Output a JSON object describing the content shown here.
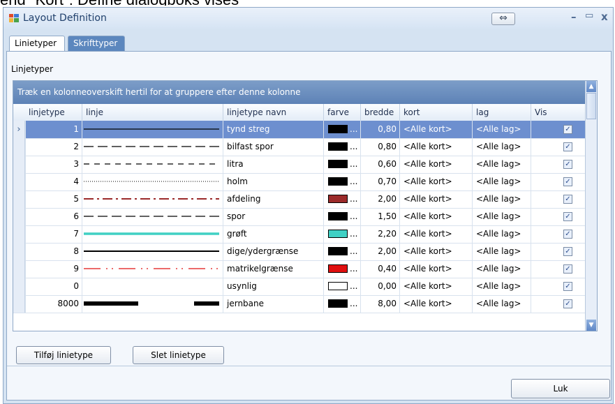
{
  "caption_text": "end \"Kort\": Define dialogboks vises",
  "window": {
    "title": "Layout Definition",
    "swap_glyph": "⇔",
    "minimize": "–",
    "maximize": "▭",
    "close": "x"
  },
  "tabs": [
    {
      "label": "Linietyper",
      "active": true
    },
    {
      "label": "Skrifttyper",
      "active": false
    }
  ],
  "section_label": "Linjetyper",
  "grid": {
    "group_hint": "Træk en kolonneoverskift hertil for at gruppere efter denne kolonne",
    "columns": [
      "linjetype",
      "linje",
      "linjetype navn",
      "farve",
      "bredde",
      "kort",
      "lag",
      "Vis"
    ],
    "row_indicator": "›",
    "ellipsis": "...",
    "check": "✓",
    "rows": [
      {
        "id": "1",
        "name": "tynd streg",
        "color": "#000000",
        "width": "0,80",
        "map": "<Alle kort>",
        "layer": "<Alle lag>",
        "vis": true,
        "selected": true,
        "line": "solid-thin",
        "line_color": "#000000"
      },
      {
        "id": "2",
        "name": "bilfast spor",
        "color": "#000000",
        "width": "0,80",
        "map": "<Alle kort>",
        "layer": "<Alle lag>",
        "vis": true,
        "line": "long-dash",
        "line_color": "#000000"
      },
      {
        "id": "3",
        "name": "litra",
        "color": "#000000",
        "width": "0,60",
        "map": "<Alle kort>",
        "layer": "<Alle lag>",
        "vis": true,
        "line": "dash",
        "line_color": "#000000"
      },
      {
        "id": "4",
        "name": "holm",
        "color": "#000000",
        "width": "0,70",
        "map": "<Alle kort>",
        "layer": "<Alle lag>",
        "vis": true,
        "line": "dotted",
        "line_color": "#000000"
      },
      {
        "id": "5",
        "name": "afdeling",
        "color": "#9b2a2a",
        "width": "2,00",
        "map": "<Alle kort>",
        "layer": "<Alle lag>",
        "vis": true,
        "line": "dash-dot",
        "line_color": "#9b2a2a"
      },
      {
        "id": "6",
        "name": "spor",
        "color": "#000000",
        "width": "1,50",
        "map": "<Alle kort>",
        "layer": "<Alle lag>",
        "vis": true,
        "line": "long-dash",
        "line_color": "#000000"
      },
      {
        "id": "7",
        "name": "grøft",
        "color": "#40d0c4",
        "width": "2,20",
        "map": "<Alle kort>",
        "layer": "<Alle lag>",
        "vis": true,
        "line": "solid-thick",
        "line_color": "#40d0c4"
      },
      {
        "id": "8",
        "name": "dige/ydergrænse",
        "color": "#000000",
        "width": "2,00",
        "map": "<Alle kort>",
        "layer": "<Alle lag>",
        "vis": true,
        "line": "solid-medium",
        "line_color": "#000000"
      },
      {
        "id": "9",
        "name": "matrikelgrænse",
        "color": "#e01010",
        "width": "0,40",
        "map": "<Alle kort>",
        "layer": "<Alle lag>",
        "vis": true,
        "line": "dash-dot-dot",
        "line_color": "#e01010"
      },
      {
        "id": "0",
        "name": "usynlig",
        "color": "#ffffff",
        "width": "0,00",
        "map": "<Alle kort>",
        "layer": "<Alle lag>",
        "vis": true,
        "line": "none",
        "line_color": "#ffffff"
      },
      {
        "id": "8000",
        "name": "jernbane",
        "color": "#000000",
        "width": "8,00",
        "map": "<Alle kort>",
        "layer": "<Alle lag>",
        "vis": true,
        "line": "rail",
        "line_color": "#000000"
      }
    ]
  },
  "buttons": {
    "add": "Tilføj linietype",
    "delete": "Slet linietype",
    "close": "Luk"
  },
  "colors": {
    "selected_row": "#6d8fcf",
    "header_bar": "#5d82b6",
    "window_bg": "#d5e3f2"
  }
}
